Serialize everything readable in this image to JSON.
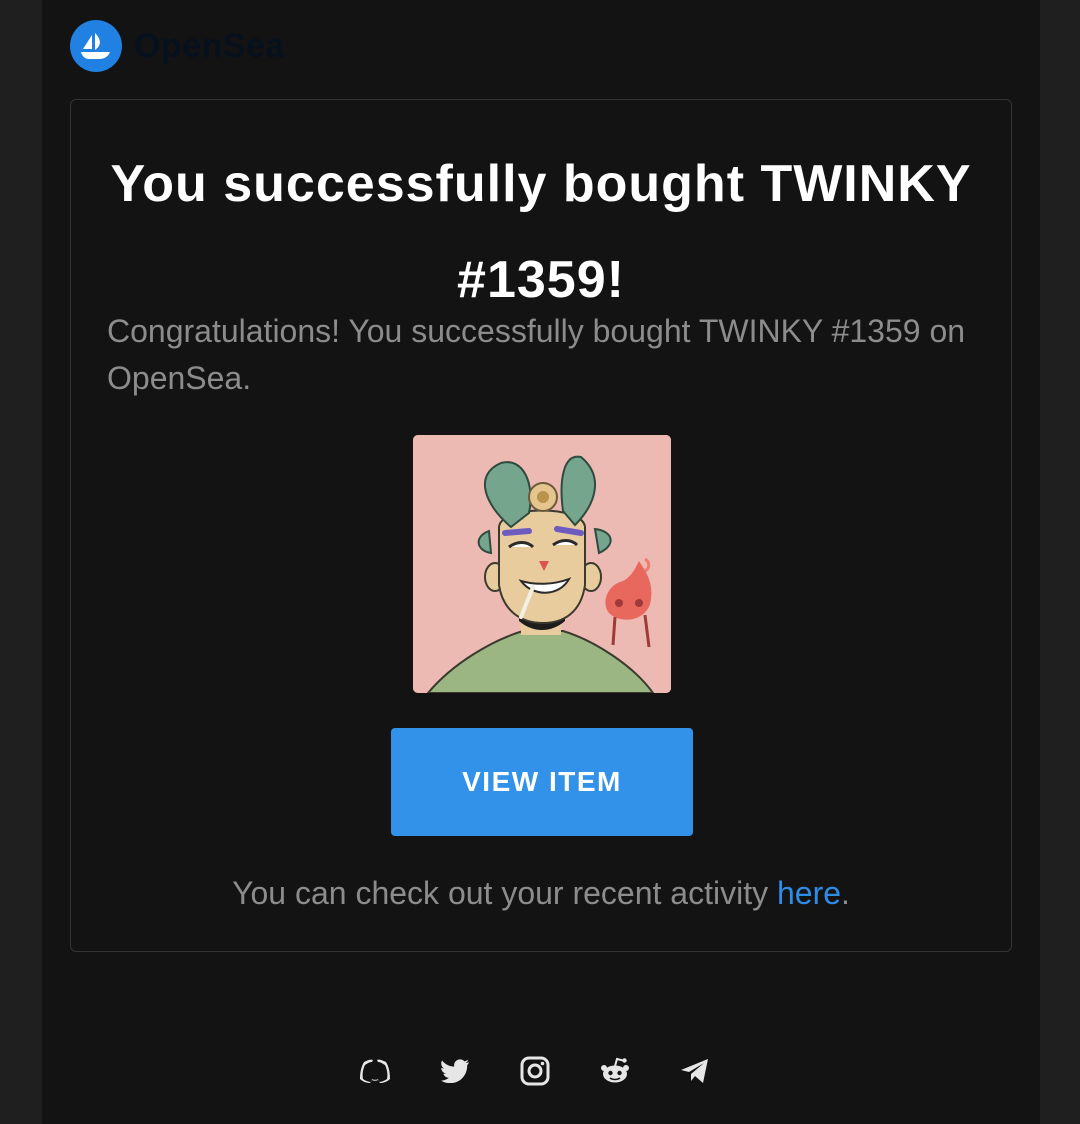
{
  "brand": {
    "name": "OpenSea",
    "accent": "#2081e2"
  },
  "card": {
    "title": "You successfully bought TWINKY #1359!",
    "message": "Congratulations! You successfully bought TWINKY #1359 on OpenSea.",
    "button_label": "VIEW ITEM",
    "activity_prefix": "You can check out your recent activity ",
    "activity_link": "here",
    "activity_suffix": "."
  },
  "socials": [
    {
      "name": "discord-icon"
    },
    {
      "name": "twitter-icon"
    },
    {
      "name": "instagram-icon"
    },
    {
      "name": "reddit-icon"
    },
    {
      "name": "telegram-icon"
    }
  ],
  "colors": {
    "background": "#131313",
    "button": "#3291e9",
    "link": "#2e8be6",
    "muted_text": "#8c8c8c"
  }
}
